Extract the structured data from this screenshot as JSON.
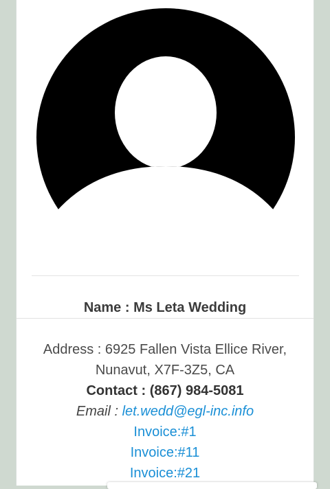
{
  "profile": {
    "avatar_icon": "user-avatar-icon",
    "name_label": "Name :",
    "name_value": "Ms Leta Wedding",
    "address_label": "Address :",
    "address_line1": "6925 Fallen Vista Ellice River,",
    "address_line2": "Nunavut, X7F-3Z5, CA",
    "contact_label": "Contact :",
    "contact_value": "(867) 984-5081",
    "email_label": "Email :",
    "email_value": "let.wedd@egl-inc.info",
    "invoices": [
      {
        "label": "Invoice:#1"
      },
      {
        "label": "Invoice:#11"
      },
      {
        "label": "Invoice:#21"
      }
    ]
  },
  "colors": {
    "background": "#cfd9d0",
    "card": "#ffffff",
    "link": "#1a8fd6",
    "avatar": "#000000"
  }
}
